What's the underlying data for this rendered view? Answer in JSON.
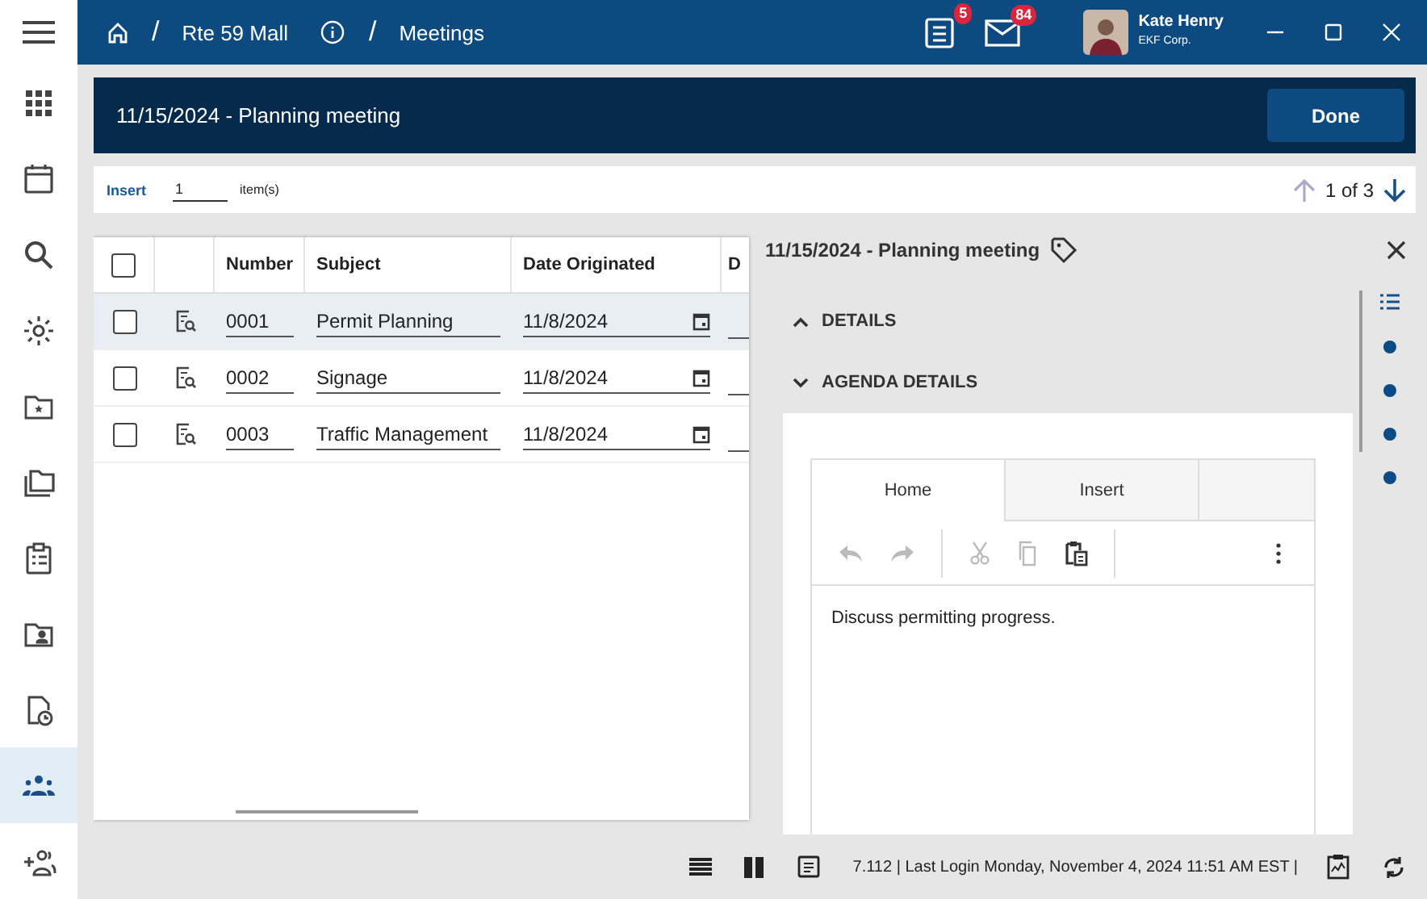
{
  "app_bar": {
    "separator": "/",
    "breadcrumbs": [
      {
        "label": "Rte 59 Mall"
      },
      {
        "label": "Meetings"
      }
    ],
    "notifications": [
      {
        "badge": "5"
      },
      {
        "badge": "84"
      }
    ],
    "user": {
      "name": "Kate Henry",
      "company": "EKF Corp."
    }
  },
  "sidebar": {
    "items": [
      {
        "selected": false
      },
      {
        "selected": false
      },
      {
        "selected": false
      },
      {
        "selected": false
      },
      {
        "selected": false
      },
      {
        "selected": false
      },
      {
        "selected": false
      },
      {
        "selected": false
      },
      {
        "selected": false
      },
      {
        "selected": true
      },
      {
        "selected": false
      }
    ]
  },
  "header": {
    "title": "11/15/2024 - Planning meeting",
    "button": "Done"
  },
  "insert_bar": {
    "label": "Insert",
    "count": "1",
    "unit": "item(s)",
    "pager": "1 of 3"
  },
  "table": {
    "all_checked": false,
    "columns": [
      "Number",
      "Subject",
      "Date Originated",
      "D"
    ],
    "rows": [
      {
        "checked": false,
        "selected": true,
        "number": "0001",
        "subject": "Permit Planning",
        "date": "11/8/2024"
      },
      {
        "checked": false,
        "selected": false,
        "number": "0002",
        "subject": "Signage",
        "date": "11/8/2024"
      },
      {
        "checked": false,
        "selected": false,
        "number": "0003",
        "subject": "Traffic Management",
        "date": "11/8/2024"
      }
    ]
  },
  "detail": {
    "title": "11/15/2024 - Planning meeting",
    "sections": [
      {
        "label": "DETAILS",
        "expanded": false
      },
      {
        "label": "AGENDA DETAILS",
        "expanded": true
      }
    ],
    "editor": {
      "tabs": [
        {
          "label": "Home",
          "selected": true
        },
        {
          "label": "Insert",
          "selected": false
        }
      ],
      "text": "Discuss permitting progress."
    }
  },
  "status_bar": {
    "text": "7.112  |  Last Login Monday, November 4, 2024 11:51 AM EST  |"
  }
}
